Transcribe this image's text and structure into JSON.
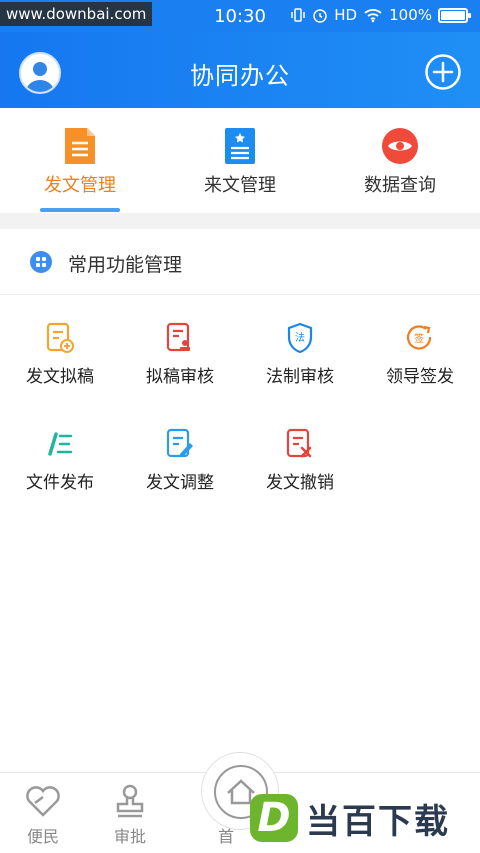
{
  "status_bar": {
    "watermark": "www.downbai.com",
    "time": "10:30",
    "network": "HD",
    "battery": "100%",
    "battery_level": 1.0
  },
  "header": {
    "title": "协同办公",
    "avatar_icon": "user-avatar-icon",
    "add_icon": "plus-circle-icon"
  },
  "tabs": [
    {
      "label": "发文管理",
      "icon": "outgoing-document-icon",
      "color": "#f8902a",
      "active": true
    },
    {
      "label": "来文管理",
      "icon": "incoming-document-icon",
      "color": "#1c8cf0",
      "active": false
    },
    {
      "label": "数据查询",
      "icon": "eye-icon",
      "color": "#f04a3a",
      "active": false
    }
  ],
  "section": {
    "title": "常用功能管理",
    "icon": "grid-apps-icon"
  },
  "functions": [
    {
      "label": "发文拟稿",
      "icon": "draft-add-icon",
      "color": "#f3a532"
    },
    {
      "label": "拟稿审核",
      "icon": "draft-review-icon",
      "color": "#e5443c"
    },
    {
      "label": "法制审核",
      "icon": "legal-shield-icon",
      "color": "#1d84e8",
      "glyph": "法"
    },
    {
      "label": "领导签发",
      "icon": "sign-off-icon",
      "color": "#f07d1f",
      "glyph": "签"
    },
    {
      "label": "文件发布",
      "icon": "publish-icon",
      "color": "#1fb6a0"
    },
    {
      "label": "发文调整",
      "icon": "edit-document-icon",
      "color": "#2a9ce8"
    },
    {
      "label": "发文撤销",
      "icon": "revoke-document-icon",
      "color": "#e5443c"
    }
  ],
  "bottom_nav": [
    {
      "label": "便民",
      "icon": "heart-tag-icon"
    },
    {
      "label": "审批",
      "icon": "stamp-icon"
    },
    {
      "label": "首",
      "icon": "home-icon"
    }
  ],
  "brand_watermark": {
    "letter": "D",
    "text": "当百下载"
  }
}
